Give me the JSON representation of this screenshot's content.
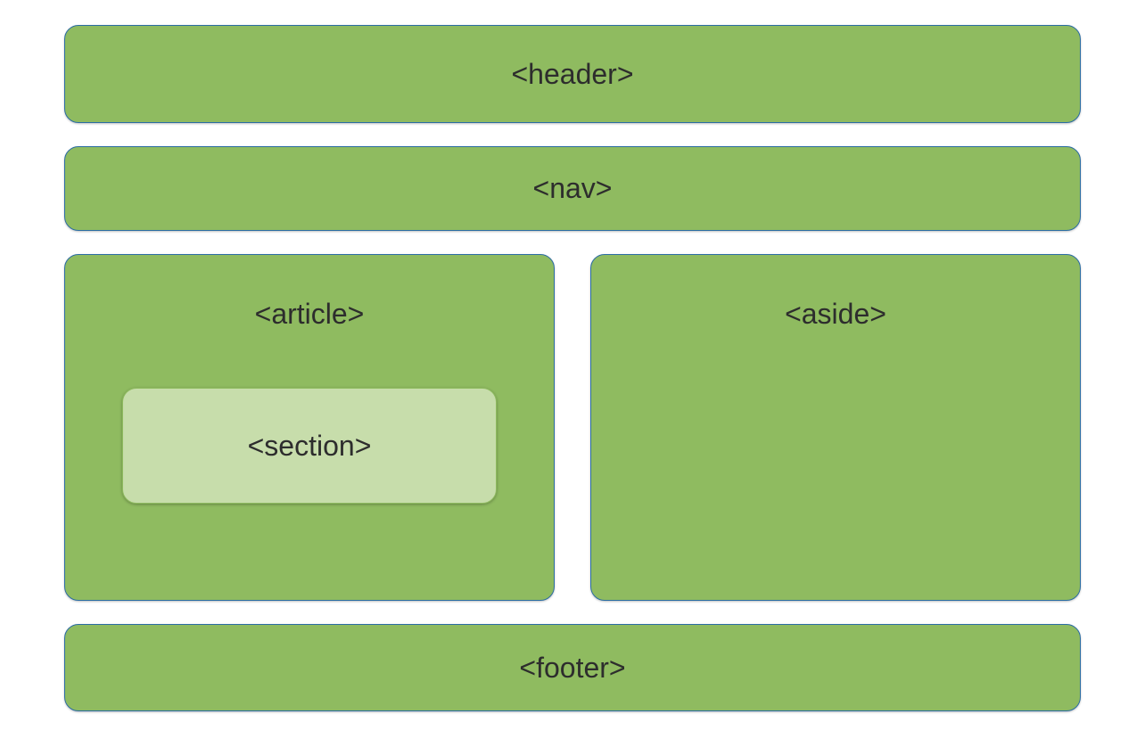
{
  "layout": {
    "header": "<header>",
    "nav": "<nav>",
    "article": "<article>",
    "section": "<section>",
    "aside": "<aside>",
    "footer": "<footer>"
  },
  "colors": {
    "main_bg": "#8fbb60",
    "inner_bg": "#c7ddab",
    "border": "#2b6da3"
  }
}
